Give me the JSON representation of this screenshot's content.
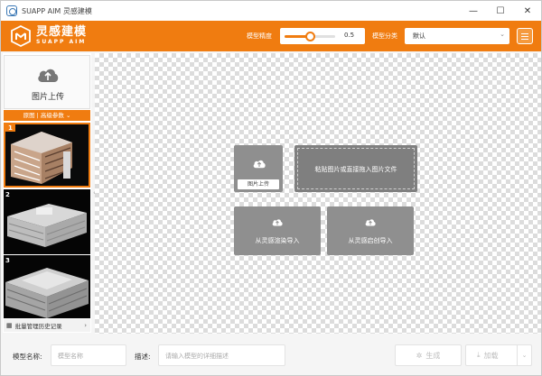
{
  "window": {
    "title": "SUAPP AIM 灵感建模",
    "minimize": "—",
    "maximize": "☐",
    "close": "✕"
  },
  "header": {
    "logo_cn": "灵感建模",
    "logo_en": "SUAPP AIM",
    "precision_label": "模型精度",
    "precision_value": "0.5",
    "precision_fraction": 0.5,
    "category_label": "模型分类",
    "category_value": "默认",
    "accent_color": "#f07c10"
  },
  "left_panel": {
    "upload_label": "图片上传",
    "param_bar": "原图 | 高级参数",
    "thumbnails": [
      {
        "num": "1",
        "selected": true
      },
      {
        "num": "2",
        "selected": false
      },
      {
        "num": "3",
        "selected": false
      }
    ],
    "history_label": "批量管理历史记录"
  },
  "canvas": {
    "upload_button_sub": "图片上传",
    "drop_text": "粘贴图片或直接拖入图片文件",
    "render_import": "从灵感渲染导入",
    "aigen_import": "从灵感启创导入"
  },
  "bottom": {
    "name_label": "模型名称:",
    "name_placeholder": "模型名称",
    "desc_label": "描述:",
    "desc_placeholder": "请输入模型的详细描述",
    "generate_label": "生成",
    "load_label": "加载"
  }
}
